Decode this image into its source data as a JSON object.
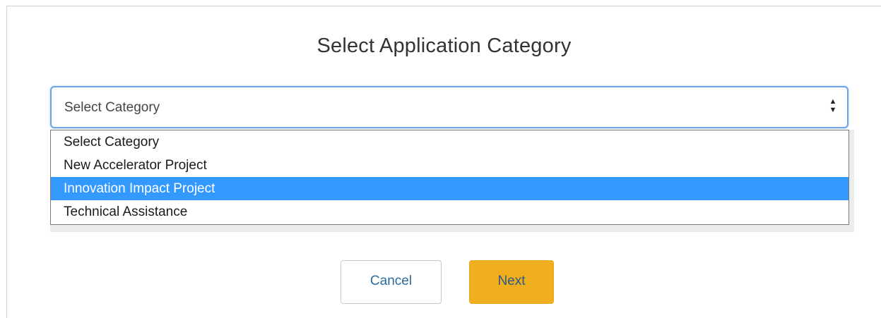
{
  "dialog": {
    "title": "Select Application Category"
  },
  "category_select": {
    "selected_value": "Select Category",
    "arrow_up": "▲",
    "arrow_down": "▼",
    "options": [
      {
        "label": "Select Category",
        "highlighted": false
      },
      {
        "label": "New Accelerator Project",
        "highlighted": false
      },
      {
        "label": "Innovation Impact Project",
        "highlighted": true
      },
      {
        "label": "Technical Assistance",
        "highlighted": false
      }
    ]
  },
  "buttons": {
    "cancel_label": "Cancel",
    "next_label": "Next"
  },
  "colors": {
    "highlight": "#3399ff",
    "next_button": "#f0ad1e",
    "focus_border": "#6ba4e7",
    "link_text": "#2b6b9b"
  }
}
